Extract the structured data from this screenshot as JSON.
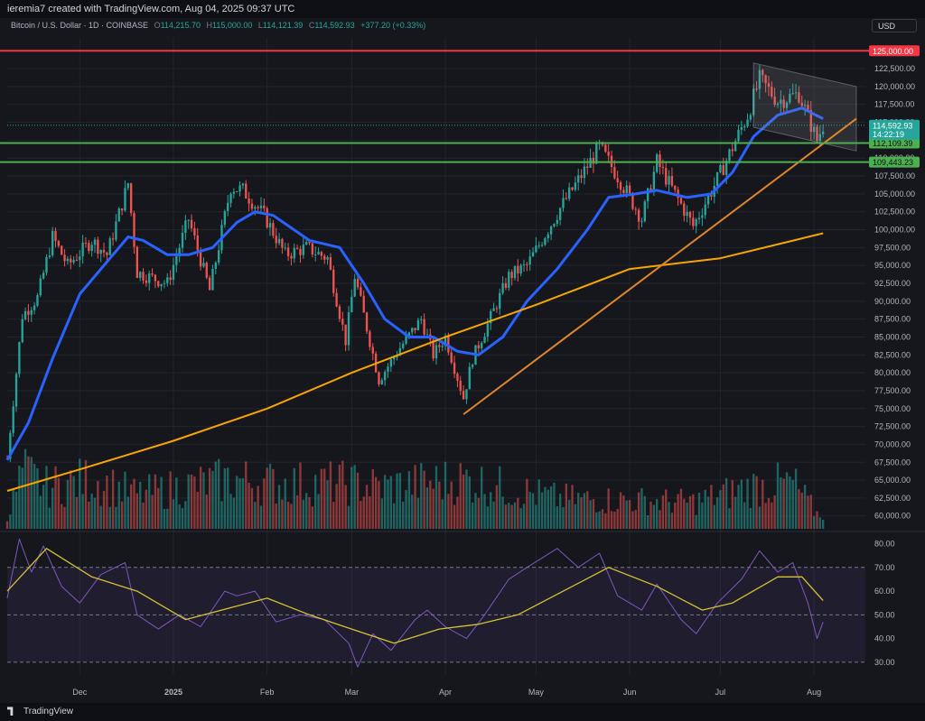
{
  "header": {
    "credit": "ieremia7 created with TradingView.com, Aug 04, 2025 09:37 UTC"
  },
  "legend": {
    "symbol": "Bitcoin / U.S. Dollar · 1D · COINBASE",
    "o_label": "O",
    "o": "114,215.70",
    "h_label": "H",
    "h": "115,000.00",
    "l_label": "L",
    "l": "114,121.39",
    "c_label": "C",
    "c": "114,592.93",
    "change": "+377.20 (+0.33%)"
  },
  "currency_button": "USD",
  "footer": {
    "brand": "TradingView"
  },
  "colors": {
    "background": "#16171d",
    "grid": "#22242c",
    "candle_up": "#26a69a",
    "candle_down": "#ef5350",
    "ma_fast": "#2962ff",
    "ma_slow": "#f7a600",
    "trendline": "#e0862a",
    "resistance": "#f23645",
    "support": "#4caf50",
    "rsi": "#7e57c2",
    "rsi_ma": "#d4c233"
  },
  "chart_data": [
    {
      "type": "candlestick",
      "y_ticks": [
        "122,500.00",
        "120,000.00",
        "117,500.00",
        "115,000.00",
        "112,500.00",
        "110,000.00",
        "107,500.00",
        "105,000.00",
        "102,500.00",
        "100,000.00",
        "97,500.00",
        "95,000.00",
        "92,500.00",
        "90,000.00",
        "87,500.00",
        "85,000.00",
        "82,500.00",
        "80,000.00",
        "77,500.00",
        "75,000.00",
        "72,500.00",
        "70,000.00",
        "67,500.00",
        "65,000.00",
        "62,500.00",
        "60,000.00"
      ],
      "ylim": [
        58200,
        126800
      ],
      "x_ticks": [
        "Dec",
        "2025",
        "Feb",
        "Mar",
        "Apr",
        "May",
        "Jun",
        "Jul",
        "Aug"
      ],
      "x_tick_dates": [
        "2024-12-01",
        "2025-01-01",
        "2025-02-01",
        "2025-03-01",
        "2025-04-01",
        "2025-05-01",
        "2025-06-01",
        "2025-07-01",
        "2025-08-01"
      ],
      "xlim": [
        "2024-11-07",
        "2025-08-18"
      ],
      "price_path": [
        [
          "2024-11-07",
          68000
        ],
        [
          "2024-11-12",
          88000
        ],
        [
          "2024-11-17",
          90500
        ],
        [
          "2024-11-22",
          99000
        ],
        [
          "2024-11-27",
          95000
        ],
        [
          "2024-12-05",
          98500
        ],
        [
          "2024-12-10",
          96500
        ],
        [
          "2024-12-17",
          106500
        ],
        [
          "2024-12-20",
          94000
        ],
        [
          "2024-12-30",
          92500
        ],
        [
          "2025-01-06",
          101500
        ],
        [
          "2025-01-13",
          91500
        ],
        [
          "2025-01-20",
          106000
        ],
        [
          "2025-01-24",
          105500
        ],
        [
          "2025-01-31",
          102000
        ],
        [
          "2025-02-07",
          96500
        ],
        [
          "2025-02-14",
          97500
        ],
        [
          "2025-02-21",
          96000
        ],
        [
          "2025-02-27",
          84500
        ],
        [
          "2025-03-02",
          93500
        ],
        [
          "2025-03-10",
          79000
        ],
        [
          "2025-03-17",
          83500
        ],
        [
          "2025-03-24",
          87500
        ],
        [
          "2025-03-28",
          82500
        ],
        [
          "2025-04-01",
          85000
        ],
        [
          "2025-04-07",
          76500
        ],
        [
          "2025-04-10",
          82000
        ],
        [
          "2025-04-22",
          93500
        ],
        [
          "2025-04-28",
          95000
        ],
        [
          "2025-05-09",
          103000
        ],
        [
          "2025-05-22",
          111500
        ],
        [
          "2025-05-28",
          107500
        ],
        [
          "2025-06-05",
          101500
        ],
        [
          "2025-06-10",
          109500
        ],
        [
          "2025-06-22",
          100500
        ],
        [
          "2025-06-30",
          107000
        ],
        [
          "2025-07-10",
          116000
        ],
        [
          "2025-07-14",
          121000
        ],
        [
          "2025-07-20",
          118000
        ],
        [
          "2025-07-27",
          119000
        ],
        [
          "2025-08-02",
          112500
        ],
        [
          "2025-08-04",
          114600
        ]
      ],
      "series": [
        {
          "name": "",
          "kind": "ma_fast",
          "points": [
            [
              "2024-11-07",
              67800
            ],
            [
              "2024-11-14",
              73000
            ],
            [
              "2024-11-22",
              82000
            ],
            [
              "2024-12-01",
              91000
            ],
            [
              "2024-12-10",
              95500
            ],
            [
              "2024-12-17",
              99000
            ],
            [
              "2024-12-22",
              98500
            ],
            [
              "2024-12-30",
              96500
            ],
            [
              "2025-01-06",
              96500
            ],
            [
              "2025-01-14",
              97500
            ],
            [
              "2025-01-22",
              101000
            ],
            [
              "2025-01-28",
              102500
            ],
            [
              "2025-02-03",
              102000
            ],
            [
              "2025-02-15",
              98500
            ],
            [
              "2025-02-25",
              97500
            ],
            [
              "2025-03-05",
              92500
            ],
            [
              "2025-03-12",
              87500
            ],
            [
              "2025-03-20",
              85000
            ],
            [
              "2025-03-28",
              85000
            ],
            [
              "2025-04-05",
              83000
            ],
            [
              "2025-04-12",
              82500
            ],
            [
              "2025-04-20",
              85000
            ],
            [
              "2025-04-28",
              90000
            ],
            [
              "2025-05-08",
              94500
            ],
            [
              "2025-05-18",
              100000
            ],
            [
              "2025-05-25",
              104500
            ],
            [
              "2025-06-03",
              105000
            ],
            [
              "2025-06-10",
              105500
            ],
            [
              "2025-06-20",
              104500
            ],
            [
              "2025-06-28",
              105000
            ],
            [
              "2025-07-05",
              108000
            ],
            [
              "2025-07-12",
              113000
            ],
            [
              "2025-07-20",
              116000
            ],
            [
              "2025-07-28",
              117000
            ],
            [
              "2025-08-04",
              115500
            ]
          ]
        },
        {
          "name": "",
          "kind": "ma_slow",
          "points": [
            [
              "2024-11-07",
              63500
            ],
            [
              "2024-12-01",
              66500
            ],
            [
              "2025-01-01",
              70500
            ],
            [
              "2025-02-01",
              75000
            ],
            [
              "2025-03-01",
              80000
            ],
            [
              "2025-04-01",
              85000
            ],
            [
              "2025-05-01",
              89500
            ],
            [
              "2025-06-01",
              94500
            ],
            [
              "2025-07-01",
              96000
            ],
            [
              "2025-08-04",
              99500
            ]
          ]
        }
      ],
      "levels": [
        {
          "label": "125,000.00",
          "value": 125000,
          "kind": "resistance"
        },
        {
          "label": "112,109.39",
          "value": 112109.39,
          "kind": "support"
        },
        {
          "label": "109,443.23",
          "value": 109443.23,
          "kind": "support"
        }
      ],
      "last_price": {
        "label": "114,592.93",
        "value": 114592.93,
        "countdown": "14:22:19"
      },
      "trendline": [
        [
          "2025-04-07",
          74200
        ],
        [
          "2025-08-15",
          115500
        ]
      ],
      "channel": {
        "upper": [
          [
            "2025-07-12",
            123300
          ],
          [
            "2025-08-15",
            120000
          ]
        ],
        "lower": [
          [
            "2025-07-12",
            114300
          ],
          [
            "2025-08-15",
            111000
          ]
        ]
      }
    },
    {
      "type": "bar",
      "kind": "volume",
      "note_scale": "relative",
      "ylim": [
        0,
        1
      ],
      "peaks": [
        [
          "2024-11-08",
          0.25
        ],
        [
          "2024-11-12",
          0.75
        ],
        [
          "2024-11-20",
          0.55
        ],
        [
          "2024-12-05",
          0.65
        ],
        [
          "2024-12-20",
          0.45
        ],
        [
          "2025-01-20",
          0.65
        ],
        [
          "2025-02-03",
          0.6
        ],
        [
          "2025-02-28",
          0.6
        ],
        [
          "2025-03-11",
          0.55
        ],
        [
          "2025-04-07",
          0.65
        ],
        [
          "2025-05-08",
          0.4
        ],
        [
          "2025-06-22",
          0.35
        ],
        [
          "2025-07-11",
          0.55
        ],
        [
          "2025-07-25",
          0.6
        ],
        [
          "2025-08-02",
          0.2
        ]
      ]
    },
    {
      "type": "line",
      "kind": "rsi",
      "y_ticks": [
        "80.00",
        "70.00",
        "60.00",
        "50.00",
        "40.00",
        "30.00"
      ],
      "ylim": [
        25,
        84
      ],
      "band": [
        30,
        70
      ],
      "series": [
        {
          "name": "",
          "kind": "rsi",
          "points": [
            [
              "2024-11-07",
              57
            ],
            [
              "2024-11-11",
              82
            ],
            [
              "2024-11-15",
              68
            ],
            [
              "2024-11-19",
              79
            ],
            [
              "2024-11-25",
              62
            ],
            [
              "2024-12-01",
              55
            ],
            [
              "2024-12-08",
              67
            ],
            [
              "2024-12-16",
              72
            ],
            [
              "2024-12-20",
              50
            ],
            [
              "2024-12-27",
              44
            ],
            [
              "2025-01-03",
              50
            ],
            [
              "2025-01-10",
              45
            ],
            [
              "2025-01-18",
              60
            ],
            [
              "2025-01-22",
              58
            ],
            [
              "2025-01-28",
              60
            ],
            [
              "2025-02-04",
              47
            ],
            [
              "2025-02-12",
              50
            ],
            [
              "2025-02-20",
              48
            ],
            [
              "2025-02-28",
              38
            ],
            [
              "2025-03-03",
              28
            ],
            [
              "2025-03-08",
              42
            ],
            [
              "2025-03-14",
              35
            ],
            [
              "2025-03-22",
              48
            ],
            [
              "2025-03-26",
              52
            ],
            [
              "2025-04-01",
              45
            ],
            [
              "2025-04-08",
              40
            ],
            [
              "2025-04-14",
              50
            ],
            [
              "2025-04-22",
              65
            ],
            [
              "2025-04-28",
              70
            ],
            [
              "2025-05-08",
              78
            ],
            [
              "2025-05-15",
              70
            ],
            [
              "2025-05-22",
              76
            ],
            [
              "2025-05-28",
              58
            ],
            [
              "2025-06-05",
              52
            ],
            [
              "2025-06-10",
              63
            ],
            [
              "2025-06-18",
              48
            ],
            [
              "2025-06-23",
              42
            ],
            [
              "2025-06-30",
              55
            ],
            [
              "2025-07-08",
              65
            ],
            [
              "2025-07-14",
              77
            ],
            [
              "2025-07-20",
              68
            ],
            [
              "2025-07-25",
              72
            ],
            [
              "2025-07-30",
              55
            ],
            [
              "2025-08-02",
              40
            ],
            [
              "2025-08-04",
              47
            ]
          ]
        },
        {
          "name": "",
          "kind": "rsi_ma",
          "points": [
            [
              "2024-11-07",
              60
            ],
            [
              "2024-11-20",
              78
            ],
            [
              "2024-12-05",
              66
            ],
            [
              "2024-12-20",
              60
            ],
            [
              "2025-01-05",
              48
            ],
            [
              "2025-01-20",
              53
            ],
            [
              "2025-02-01",
              57
            ],
            [
              "2025-02-15",
              50
            ],
            [
              "2025-03-01",
              44
            ],
            [
              "2025-03-15",
              38
            ],
            [
              "2025-03-30",
              44
            ],
            [
              "2025-04-12",
              46
            ],
            [
              "2025-04-25",
              50
            ],
            [
              "2025-05-10",
              60
            ],
            [
              "2025-05-25",
              70
            ],
            [
              "2025-06-10",
              62
            ],
            [
              "2025-06-25",
              52
            ],
            [
              "2025-07-05",
              55
            ],
            [
              "2025-07-20",
              66
            ],
            [
              "2025-07-28",
              66
            ],
            [
              "2025-08-04",
              56
            ]
          ]
        }
      ]
    }
  ]
}
